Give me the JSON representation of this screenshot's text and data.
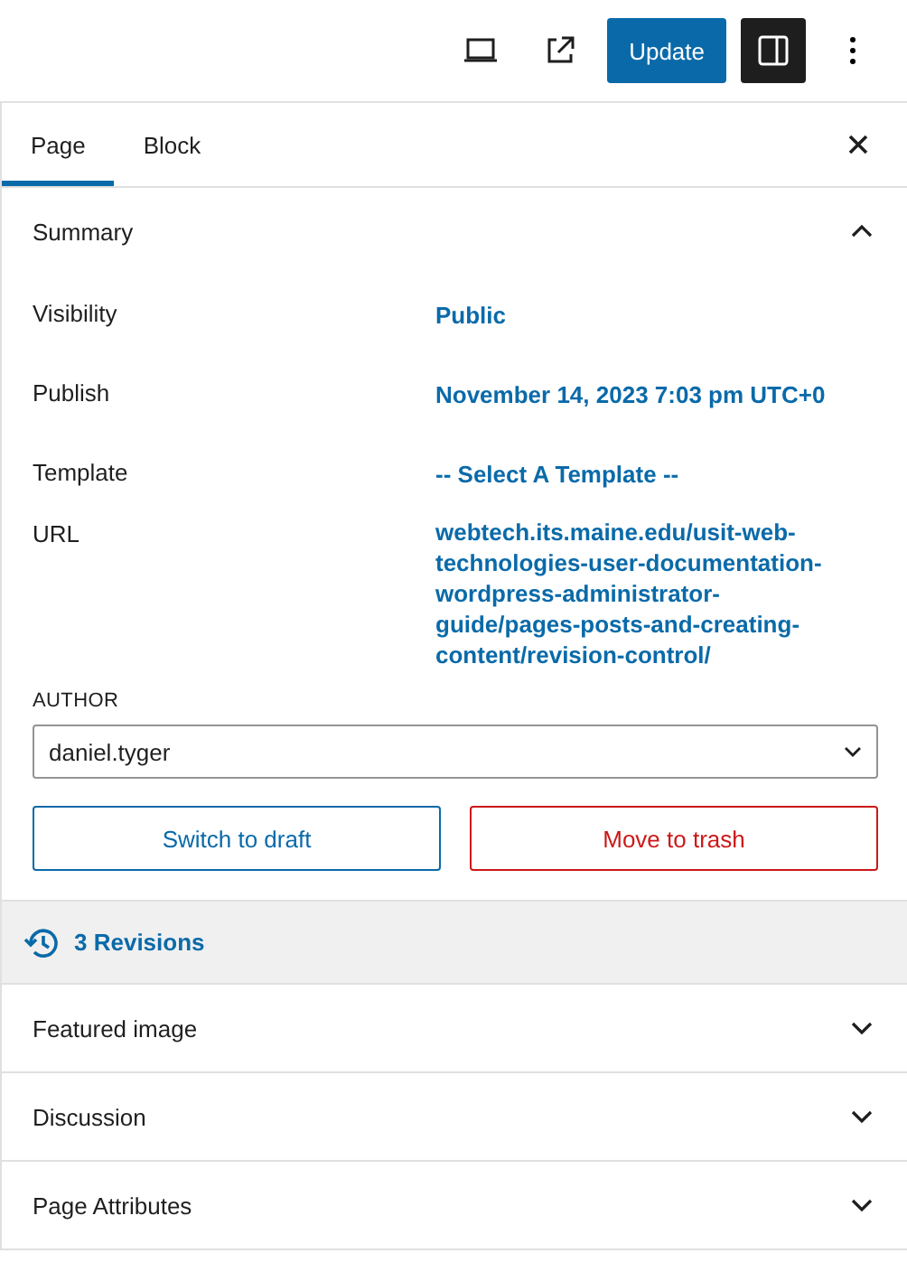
{
  "toolbar": {
    "update_button": "Update",
    "sidebar_toggle_on": true
  },
  "tabs": [
    {
      "label": "Page",
      "selected": true
    },
    {
      "label": "Block",
      "selected": false
    }
  ],
  "summary": {
    "title": "Summary",
    "expanded": true,
    "rows": [
      {
        "label": "Visibility",
        "value": "Public"
      },
      {
        "label": "Publish",
        "value": "November 14, 2023 7:03 pm UTC+0"
      },
      {
        "label": "Template",
        "value": "-- Select A Template --"
      },
      {
        "label": "URL",
        "value": "webtech.its.maine.edu/usit-web-technologies-user-documentation-wordpress-administrator-guide/pages-posts-and-creating-content/revision-control/"
      }
    ],
    "author_label": "AUTHOR",
    "author_value": "daniel.tyger",
    "switch_button": "Switch to draft",
    "trash_button": "Move to trash"
  },
  "revisions": "3 Revisions",
  "panels": [
    {
      "title": "Featured image",
      "expanded": false
    },
    {
      "title": "Discussion",
      "expanded": false
    },
    {
      "title": "Page Attributes",
      "expanded": false
    }
  ]
}
